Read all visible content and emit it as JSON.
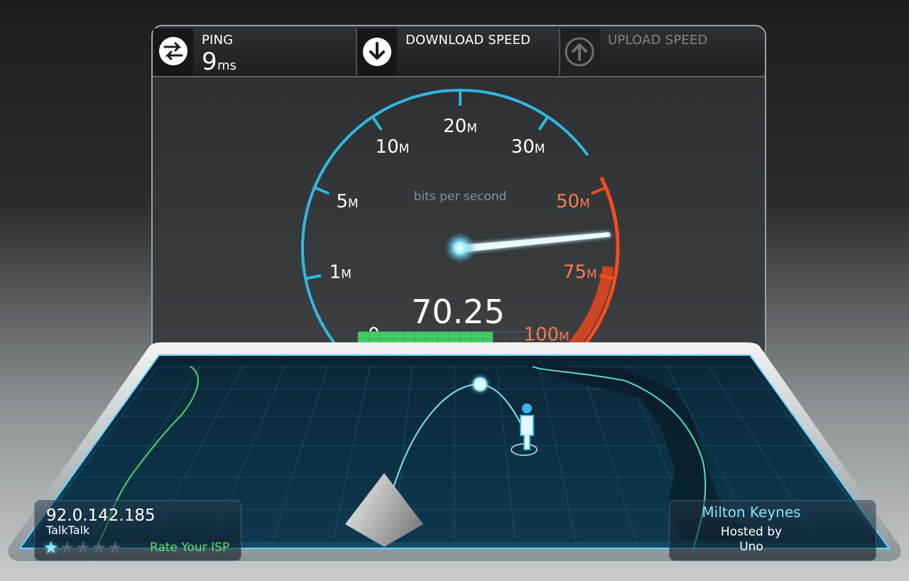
{
  "header": {
    "ping": {
      "label": "PING",
      "value": "9",
      "unit": "ms"
    },
    "download": {
      "label": "DOWNLOAD SPEED"
    },
    "upload": {
      "label": "UPLOAD SPEED"
    }
  },
  "gauge": {
    "unit_caption": "bits per second",
    "reading": "70.25",
    "reading_value": 70.25,
    "scale_labels": [
      {
        "text": "0",
        "suffix": ""
      },
      {
        "text": "1",
        "suffix": "M"
      },
      {
        "text": "5",
        "suffix": "M"
      },
      {
        "text": "10",
        "suffix": "M"
      },
      {
        "text": "20",
        "suffix": "M"
      },
      {
        "text": "30",
        "suffix": "M"
      },
      {
        "text": "50",
        "suffix": "M"
      },
      {
        "text": "75",
        "suffix": "M"
      },
      {
        "text": "100",
        "suffix": "M"
      }
    ],
    "progress_fraction": 0.66,
    "colors": {
      "arc_blue": "#2fb8e0",
      "arc_red": "#ff4a1a",
      "progress": "#3fcf62"
    }
  },
  "client": {
    "ip": "92.0.142.185",
    "isp": "TalkTalk",
    "rating": 1,
    "rating_max": 5,
    "rate_label": "Rate Your ISP"
  },
  "server": {
    "city": "Milton Keynes",
    "hosted_by": "Hosted by",
    "host": "Uno"
  },
  "icons": [
    "ping-icon",
    "download-icon",
    "upload-icon",
    "server-pyramid-icon",
    "user-figure-icon",
    "star-icon"
  ]
}
